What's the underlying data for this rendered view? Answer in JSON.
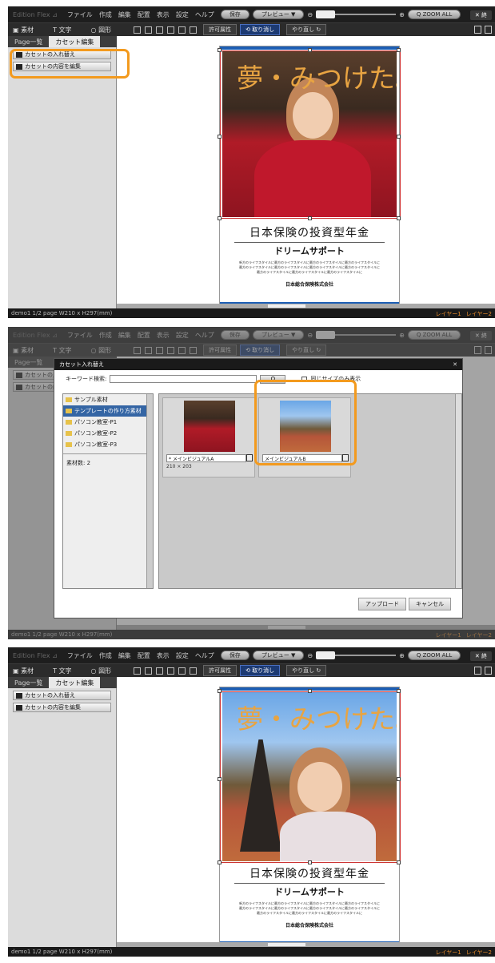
{
  "app": {
    "name": "Edition Flex ⊿",
    "menus": [
      "ファイル",
      "作成",
      "編集",
      "配置",
      "表示",
      "設定",
      "ヘルプ"
    ],
    "save": "保存",
    "preview": "プレビュー ▼",
    "zoom_all": "Q ZOOM ALL",
    "close": "✕ 終"
  },
  "toolbar": {
    "material": "素材",
    "text": "T 文字",
    "shape": "○ 図形",
    "perm": "許可属性",
    "undo": "⟲ 取り消し",
    "redo": "やり直し ↻"
  },
  "tabs": {
    "page_list": "Page一覧",
    "cassette_edit": "カセット編集"
  },
  "sidebar": {
    "swap": "カセットの入れ替え",
    "edit_contents": "カセットの内容を編集"
  },
  "status": {
    "doc": "demo1  1/2 page W210 x H297(mm)",
    "layer1": "レイヤー1",
    "layer2": "レイヤー2"
  },
  "poster": {
    "headline": "夢・みつけた。",
    "product": "日本保険の投資型年金",
    "subtitle": "ドリームサポート",
    "body": "新方のライフスタイルに最方のライフスタイルに最方のライフスタイルに最方のライフスタイルに最方のライフスタイルに最方のライフスタイルに最方のライフスタイルに最方のライフスタイルに最方のライフスタイルに最方のライフスタイルに最方のライフスタイルに",
    "company": "日本総合保険株式会社"
  },
  "dialog": {
    "title": "カセット入れ替え",
    "close": "✕",
    "search_label": "キーワード検索:",
    "search_button": "Q",
    "same_size": "同じサイズのみ表示",
    "tree": [
      "サンプル素材",
      "テンプレートの作り方素材",
      "パソコン教室-P1",
      "パソコン教室-P2",
      "パソコン教室-P3"
    ],
    "count": "素材数: 2",
    "items": [
      {
        "name": "* メインビジュアルA",
        "size": "210 × 203"
      },
      {
        "name": "メインビジュアルB",
        "size": ""
      }
    ],
    "upload": "アップロード",
    "cancel": "キャンセル"
  },
  "colors": {
    "accent": "#f39a1e",
    "brand_blue": "#1d5eb4",
    "headline": "#e8a442"
  }
}
